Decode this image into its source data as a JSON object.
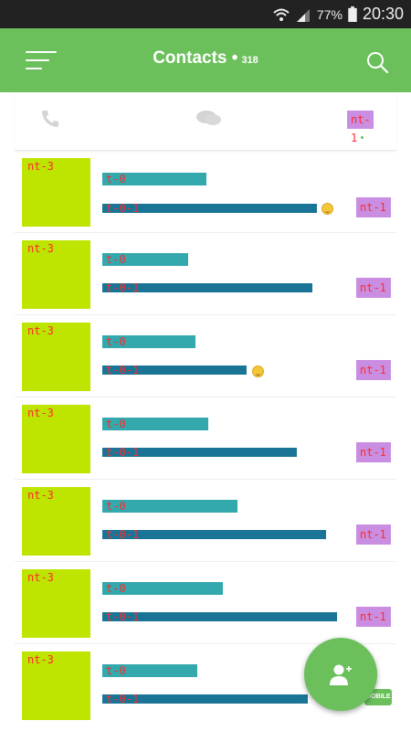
{
  "status_bar": {
    "battery": "77%",
    "time": "20:30",
    "signal_label": "R"
  },
  "app_bar": {
    "title": "Contacts",
    "count": "318"
  },
  "tabs": [
    {
      "name": "phone",
      "icon": "phone-icon"
    },
    {
      "name": "chat",
      "icon": "chat-icon"
    },
    {
      "name": "tag",
      "label": "nt-1"
    }
  ],
  "contacts": [
    {
      "avatar": "nt-3",
      "name": "t-0",
      "message": "t-0-1",
      "badge": "nt-1",
      "emoji": "smile"
    },
    {
      "avatar": "nt-3",
      "name": "t-0",
      "message": "t-0-1",
      "badge": "nt-1",
      "emoji": ""
    },
    {
      "avatar": "nt-3",
      "name": "t-0",
      "message": "t-0-1",
      "badge": "nt-1",
      "emoji": "sad"
    },
    {
      "avatar": "nt-3",
      "name": "t-0",
      "message": "t-0-1",
      "badge": "nt-1",
      "emoji": ""
    },
    {
      "avatar": "nt-3",
      "name": "t-0",
      "message": "t-0-1",
      "badge": "nt-1",
      "emoji": ""
    },
    {
      "avatar": "nt-3",
      "name": "t-0",
      "message": "t-0-1",
      "badge": "nt-1",
      "emoji": ""
    },
    {
      "avatar": "nt-3",
      "name": "t-0",
      "message": "t-0-1",
      "badge": "",
      "emoji": ""
    }
  ],
  "mobile_tag": "MOBILE",
  "colors": {
    "primary": "#6bc05b",
    "avatar_placeholder": "#bde500",
    "name_bar": "#33a8ad",
    "message_bar": "#1a7496",
    "badge": "#c98ee2"
  }
}
